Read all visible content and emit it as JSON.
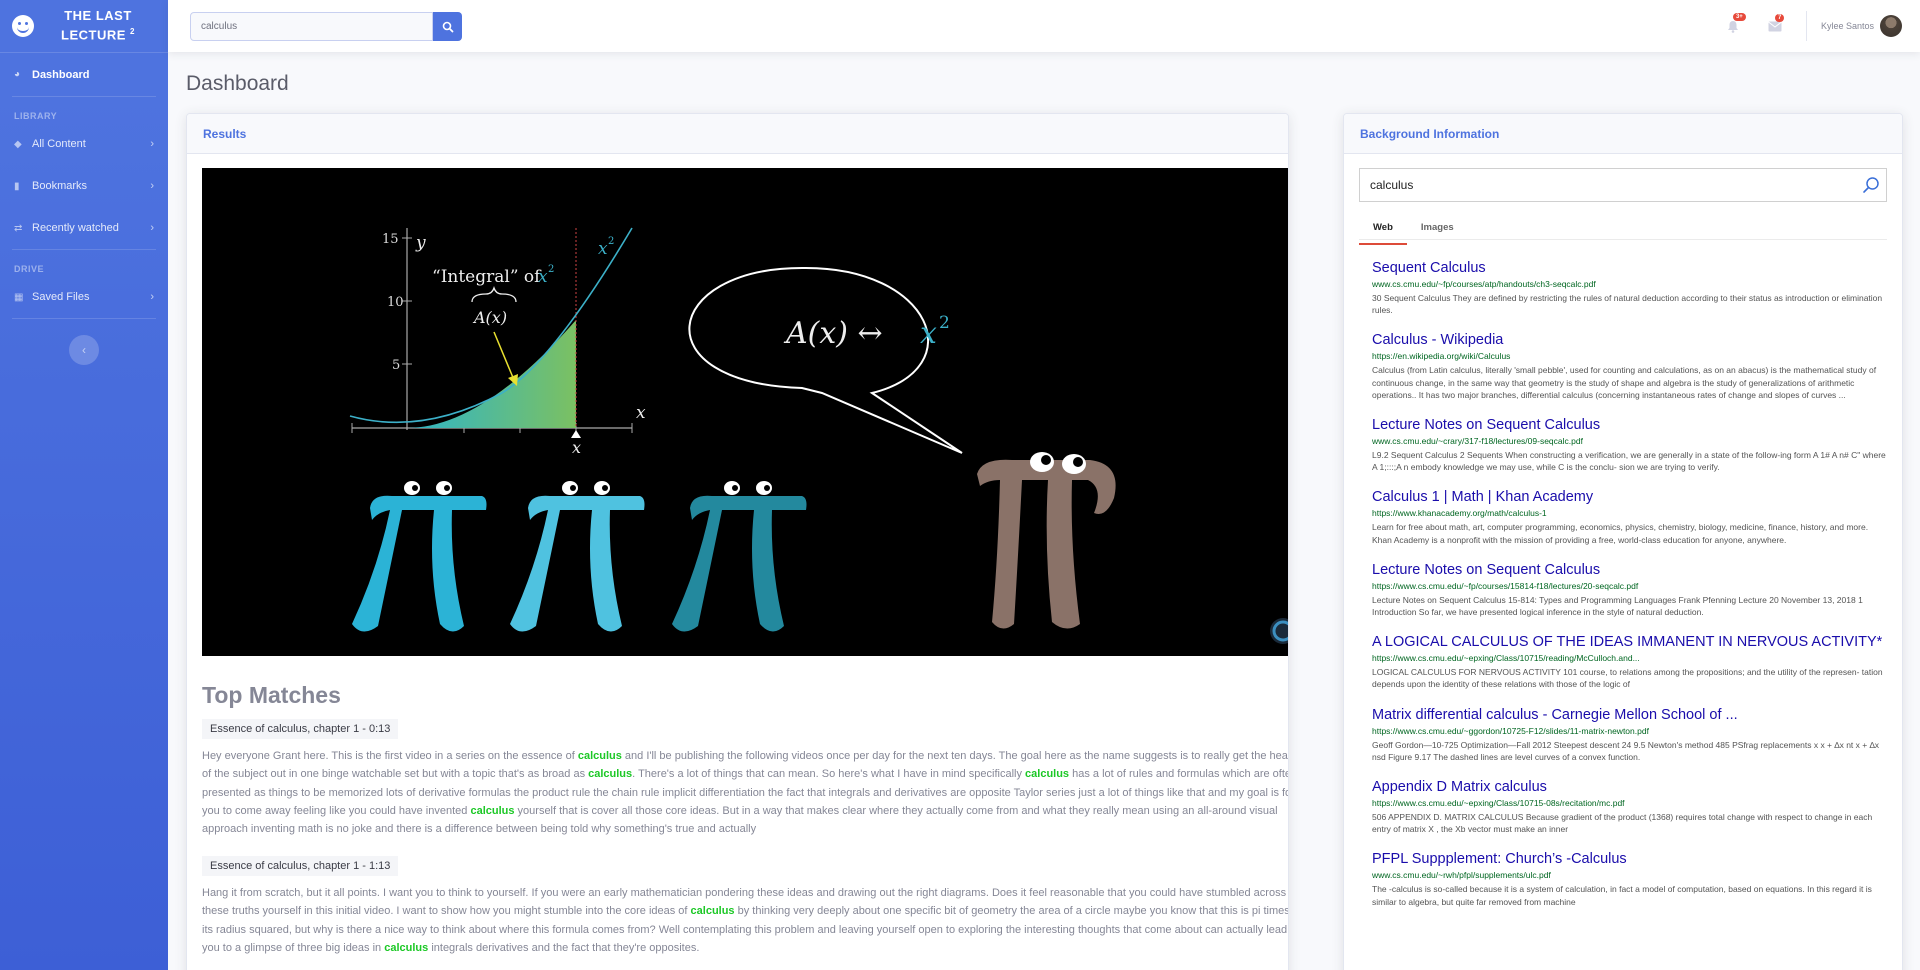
{
  "brand": {
    "line1": "THE LAST",
    "line2": "LECTURE",
    "sup": "2"
  },
  "sidebar": {
    "dashboard": "Dashboard",
    "library_heading": "LIBRARY",
    "library_items": [
      "All Content",
      "Bookmarks",
      "Recently watched"
    ],
    "drive_heading": "DRIVE",
    "drive_items": [
      "Saved Files"
    ]
  },
  "topbar": {
    "search_value": "calculus",
    "alerts_badge": "3+",
    "messages_badge": "7",
    "user_name": "Kylee Santos"
  },
  "page_title": "Dashboard",
  "results": {
    "header": "Results",
    "video": {
      "integral_label": "“Integral” of",
      "area_label": "A(x)",
      "y_axis": "y",
      "x_axis": "x",
      "x_marker": "x",
      "curve_label": "x",
      "curve_exp": "2",
      "ticks": [
        "15",
        "10",
        "5"
      ],
      "speech_left": "A(x) ↔",
      "speech_right": "x",
      "speech_exp": "2"
    },
    "top_matches_title": "Top Matches",
    "matches": [
      {
        "label": "Essence of calculus, chapter 1 - 0:13",
        "parts": [
          "Hey everyone Grant here. This is the first video in a series on the essence of ",
          "calculus",
          " and I'll be publishing the following videos once per day for the next ten days. The goal here as the name suggests is to really get the heart of the subject out in one binge watchable set but with a topic that's as broad as ",
          "calculus",
          ". There's a lot of things that can mean. So here's what I have in mind specifically ",
          "calculus",
          " has a lot of rules and formulas which are often presented as things to be memorized lots of derivative formulas the product rule the chain rule implicit differentiation the fact that integrals and derivatives are opposite Taylor series just a lot of things like that and my goal is for you to come away feeling like you could have invented ",
          "calculus",
          " yourself that is cover all those core ideas. But in a way that makes clear where they actually come from and what they really mean using an all-around visual approach inventing math is no joke and there is a difference between being told why something's true and actually"
        ]
      },
      {
        "label": "Essence of calculus, chapter 1 - 1:13",
        "parts": [
          "Hang it from scratch, but it all points. I want you to think to yourself. If you were an early mathematician pondering these ideas and drawing out the right diagrams. Does it feel reasonable that you could have stumbled across these truths yourself in this initial video. I want to show how you might stumble into the core ideas of ",
          "calculus",
          " by thinking very deeply about one specific bit of geometry the area of a circle maybe you know that this is pi times its radius squared, but why is there a nice way to think about where this formula comes from? Well contemplating this problem and leaving yourself open to exploring the interesting thoughts that come about can actually lead you to a glimpse of three big ideas in ",
          "calculus",
          " integrals derivatives and the fact that they're opposites."
        ]
      }
    ]
  },
  "background": {
    "header": "Background Information",
    "search_value": "calculus",
    "tabs": [
      "Web",
      "Images"
    ],
    "results": [
      {
        "title": "Sequent Calculus",
        "url": "www.cs.cmu.edu/~fp/courses/atp/handouts/ch3-seqcalc.pdf",
        "snippet": "30 Sequent Calculus They are defined by restricting the rules of natural deduction according to their status as introduction or elimination rules."
      },
      {
        "title": "Calculus - Wikipedia",
        "url": "https://en.wikipedia.org/wiki/Calculus",
        "snippet": "Calculus (from Latin calculus, literally 'small pebble', used for counting and calculations, as on an abacus) is the mathematical study of continuous change, in the same way that geometry is the study of shape and algebra is the study of generalizations of arithmetic operations.. It has two major branches, differential calculus (concerning instantaneous rates of change and slopes of curves ..."
      },
      {
        "title": "Lecture Notes on Sequent Calculus",
        "url": "www.cs.cmu.edu/~crary/317-f18/lectures/09-seqcalc.pdf",
        "snippet": "L9.2 Sequent Calculus 2 Sequents When constructing a verification, we are generally in a state of the follow-ing form A 1# A n# C\" where A 1;:::;A n embody knowledge we may use, while C is the conclu- sion we are trying to verify."
      },
      {
        "title": "Calculus 1 | Math | Khan Academy",
        "url": "https://www.khanacademy.org/math/calculus-1",
        "snippet": "Learn for free about math, art, computer programming, economics, physics, chemistry, biology, medicine, finance, history, and more. Khan Academy is a nonprofit with the mission of providing a free, world-class education for anyone, anywhere."
      },
      {
        "title": "Lecture Notes on Sequent Calculus",
        "url": "https://www.cs.cmu.edu/~fp/courses/15814-f18/lectures/20-seqcalc.pdf",
        "snippet": "Lecture Notes on Sequent Calculus 15-814: Types and Programming Languages Frank Pfenning Lecture 20 November 13, 2018 1 Introduction So far, we have presented logical inference in the style of natural deduction."
      },
      {
        "title": "A LOGICAL CALCULUS OF THE IDEAS IMMANENT IN NERVOUS ACTIVITY*",
        "url": "https://www.cs.cmu.edu/~epxing/Class/10715/reading/McCulloch.and...",
        "snippet": "LOGICAL CALCULUS FOR NERVOUS ACTIVITY 101 course, to relations among the propositions; and the utility of the represen- tation depends upon the identity of these relations with those of the logic of"
      },
      {
        "title": "Matrix differential calculus - Carnegie Mellon School of ...",
        "url": "https://www.cs.cmu.edu/~ggordon/10725-F12/slides/11-matrix-newton.pdf",
        "snippet": "Geoff Gordon—10-725 Optimization—Fall 2012 Steepest descent 24 9.5 Newton's method 485 PSfrag replacements x x + ∆x nt x + ∆x nsd Figure 9.17 The dashed lines are level curves of a convex function."
      },
      {
        "title": "Appendix D Matrix calculus",
        "url": "https://www.cs.cmu.edu/~epxing/Class/10715-08s/recitation/mc.pdf",
        "snippet": "506 APPENDIX D. MATRIX CALCULUS Because gradient of the product (1368) requires total change with respect to change in each entry of matrix X , the Xb vector must make an inner"
      },
      {
        "title": "PFPL Suppplement: Church’s -Calculus",
        "url": "www.cs.cmu.edu/~rwh/pfpl/supplements/ulc.pdf",
        "snippet": "The -calculus is so-called because it is a system of calculation, in fact a model of computation, based on equations. In this regard it is similar to algebra, but quite far removed from machine"
      }
    ]
  }
}
